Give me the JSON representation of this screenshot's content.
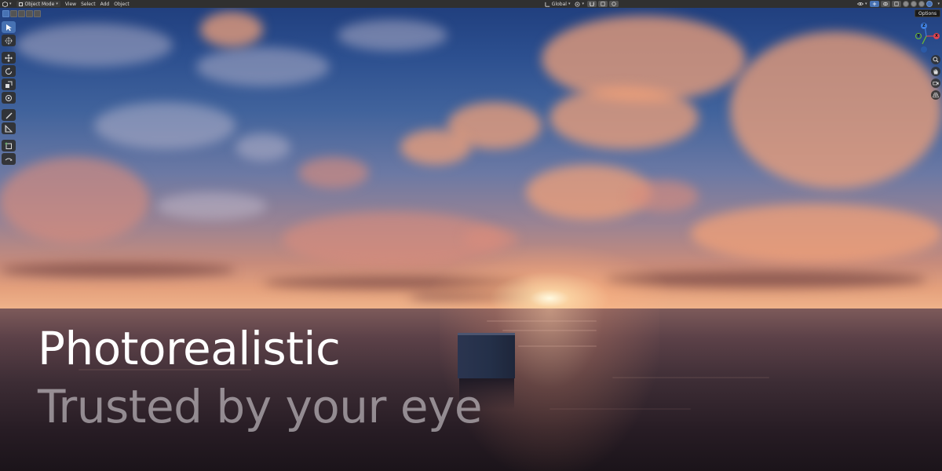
{
  "header": {
    "editor_icon": "3d-viewport-icon",
    "mode": "Object Mode",
    "menus": [
      "View",
      "Select",
      "Add",
      "Object"
    ],
    "transform_orientation": "Global",
    "options_tooltip": "Options"
  },
  "selection_modes": [
    "vertex-select-icon",
    "edge-select-icon",
    "face-select-icon",
    "extend-icon",
    "intersect-icon"
  ],
  "toolbar": {
    "tools": [
      "select-box-icon",
      "cursor-icon",
      "move-icon",
      "rotate-icon",
      "scale-icon",
      "transform-icon",
      "annotate-icon",
      "measure-icon",
      "add-cube-icon",
      "sphere-rotate-icon"
    ],
    "active_tool": "select-box-icon"
  },
  "gizmo": {
    "axes": [
      "X",
      "Y",
      "Z"
    ],
    "colors": {
      "x": "#e0434f",
      "y": "#6fbf2f",
      "z": "#3f7fe0",
      "accent": "#4772b3"
    }
  },
  "navigation": [
    "zoom-icon",
    "hand-pan-icon",
    "camera-icon",
    "grid-perspective-icon"
  ],
  "overlay": {
    "headline": "Photorealistic",
    "subline": "Trusted by your eye"
  }
}
